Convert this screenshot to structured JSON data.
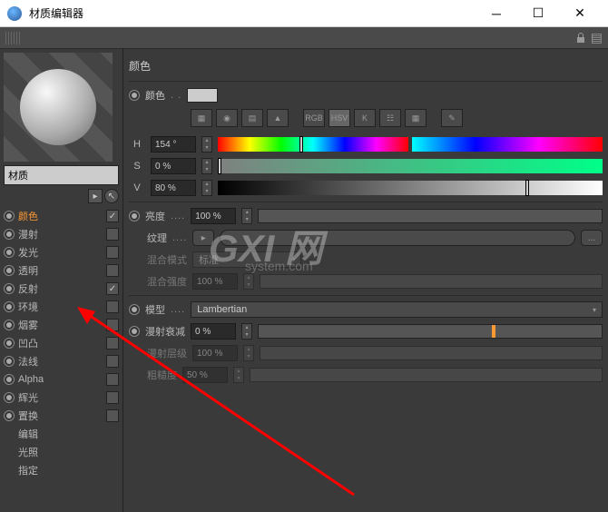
{
  "window": {
    "title": "材质编辑器"
  },
  "material": {
    "name": "材质"
  },
  "channels": [
    {
      "label": "颜色",
      "radio": true,
      "checked": true,
      "active": true
    },
    {
      "label": "漫射",
      "radio": true,
      "checked": false
    },
    {
      "label": "发光",
      "radio": true,
      "checked": false
    },
    {
      "label": "透明",
      "radio": true,
      "checked": false
    },
    {
      "label": "反射",
      "radio": true,
      "checked": true
    },
    {
      "label": "环境",
      "radio": true,
      "checked": false
    },
    {
      "label": "烟雾",
      "radio": true,
      "checked": false
    },
    {
      "label": "凹凸",
      "radio": true,
      "checked": false
    },
    {
      "label": "法线",
      "radio": true,
      "checked": false
    },
    {
      "label": "Alpha",
      "radio": true,
      "checked": false
    },
    {
      "label": "辉光",
      "radio": true,
      "checked": false
    },
    {
      "label": "置换",
      "radio": true,
      "checked": false
    },
    {
      "label": "编辑",
      "radio": false
    },
    {
      "label": "光照",
      "radio": false
    },
    {
      "label": "指定",
      "radio": false
    }
  ],
  "panel": {
    "title": "颜色",
    "color_label": "颜色",
    "hsv": {
      "h": "154 °",
      "s": "0 %",
      "v": "80 %"
    },
    "brightness_label": "亮度",
    "brightness_value": "100 %",
    "texture_label": "纹理",
    "blend_mode_label": "混合模式",
    "blend_mode_value": "标准",
    "blend_strength_label": "混合强度",
    "blend_strength_value": "100 %",
    "model_label": "模型",
    "model_value": "Lambertian",
    "falloff_label": "漫射衰减",
    "falloff_value": "0 %",
    "diffuse_level_label": "漫射层级",
    "diffuse_level_value": "100 %",
    "roughness_label": "粗糙度",
    "roughness_value": "50 %",
    "icons": {
      "rgb": "RGB",
      "hsv": "HSV",
      "k": "K"
    }
  },
  "watermark": {
    "main": "GXI 网",
    "sub": "system.com"
  }
}
